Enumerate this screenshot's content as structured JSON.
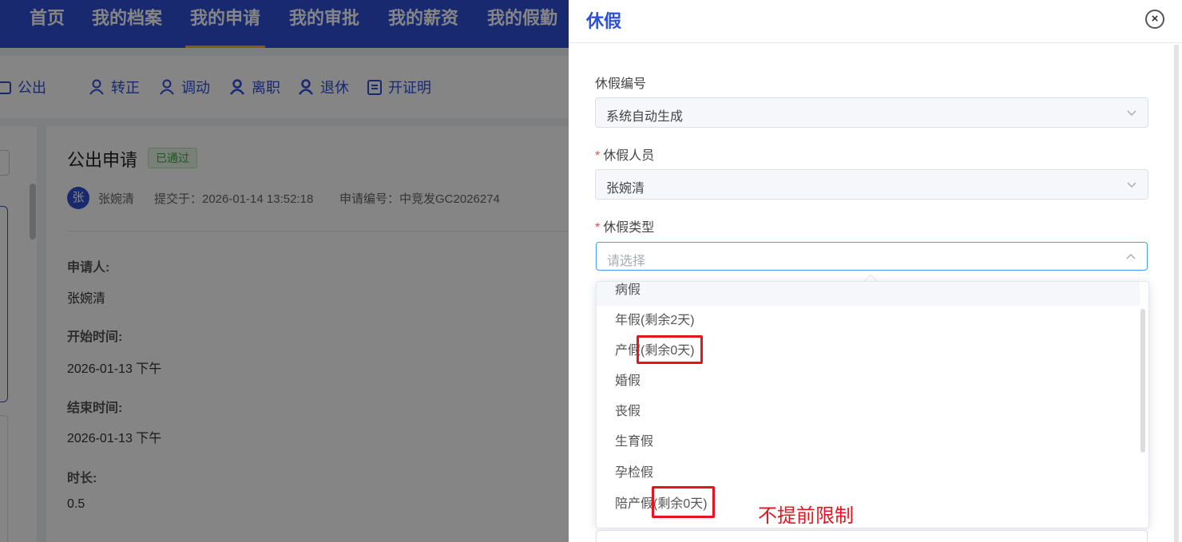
{
  "nav": {
    "items": [
      "首页",
      "我的档案",
      "我的申请",
      "我的审批",
      "我的薪资",
      "我的假勤"
    ],
    "active_index": 2
  },
  "subnav": {
    "items": [
      "公出",
      "转正",
      "调动",
      "离职",
      "退休",
      "开证明"
    ]
  },
  "detail": {
    "title": "公出申请",
    "status": "已通过",
    "avatar_char": "张",
    "applicant_name": "张婉清",
    "submitted": "提交于：2026-01-14 13:52:18",
    "apply_no": "申请编号：中竞发GC2026274",
    "fields": [
      {
        "label": "申请人:",
        "value": "张婉清"
      },
      {
        "label": "开始时间:",
        "value": "2026-01-13 下午"
      },
      {
        "label": "结束时间:",
        "value": "2026-01-13 下午"
      },
      {
        "label": "时长:",
        "value": "0.5"
      }
    ]
  },
  "drawer": {
    "title": "休假",
    "close_icon": "close-icon",
    "leave_no": {
      "label": "休假编号",
      "value": "系统自动生成"
    },
    "person": {
      "label": "休假人员",
      "required_mark": "*",
      "value": "张婉清"
    },
    "type": {
      "label": "休假类型",
      "required_mark": "*",
      "placeholder": "请选择",
      "open": true
    },
    "options": [
      "病假",
      "年假(剩余2天)",
      "产假(剩余0天)",
      "婚假",
      "丧假",
      "生育假",
      "孕检假",
      "陪产假(剩余0天)"
    ]
  },
  "annotation": {
    "text": "不提前限制",
    "color": "#e8141d"
  },
  "colors": {
    "primary": "#2e4fd6",
    "nav_active_underline": "#f5b400",
    "status_green": "#3aa845",
    "highlight_red": "#e8141d"
  }
}
